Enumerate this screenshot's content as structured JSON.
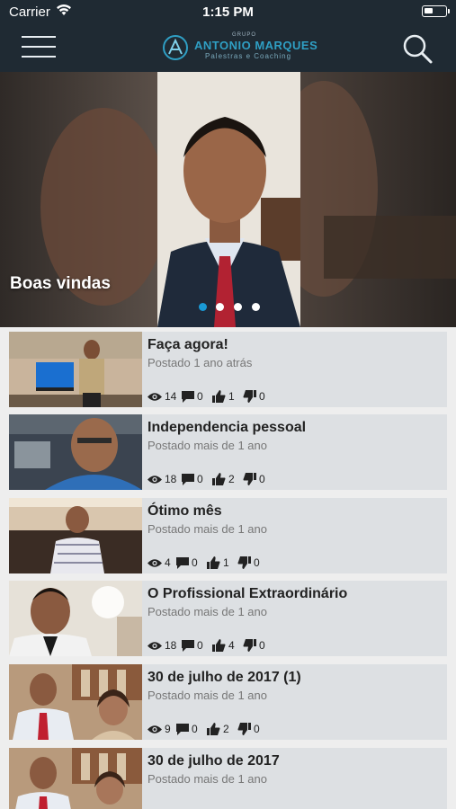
{
  "status_bar": {
    "carrier": "Carrier",
    "time": "1:15 PM"
  },
  "header": {
    "logo_group": "GRUPO",
    "logo_name": "ANTONIO MARQUES",
    "logo_tagline": "Palestras e Coaching"
  },
  "hero": {
    "title": "Boas vindas",
    "slide_count": 4,
    "active_slide": 0,
    "accent": "#1a9ad6"
  },
  "videos": [
    {
      "title": "Faça agora!",
      "posted": "Postado 1 ano atrás",
      "views": "14",
      "comments": "0",
      "likes": "1",
      "dislikes": "0"
    },
    {
      "title": "Independencia pessoal",
      "posted": "Postado mais de 1 ano",
      "views": "18",
      "comments": "0",
      "likes": "2",
      "dislikes": "0"
    },
    {
      "title": "Ótimo mês",
      "posted": "Postado mais de 1 ano",
      "views": "4",
      "comments": "0",
      "likes": "1",
      "dislikes": "0"
    },
    {
      "title": "O Profissional Extraordinário",
      "posted": "Postado mais de 1 ano",
      "views": "18",
      "comments": "0",
      "likes": "4",
      "dislikes": "0"
    },
    {
      "title": "30 de julho de 2017 (1)",
      "posted": "Postado mais de 1 ano",
      "views": "9",
      "comments": "0",
      "likes": "2",
      "dislikes": "0"
    },
    {
      "title": "30 de julho de 2017",
      "posted": "Postado mais de 1 ano",
      "views": "",
      "comments": "",
      "likes": "",
      "dislikes": ""
    }
  ],
  "colors": {
    "header_bg": "#1f2a33",
    "card_bg": "#dde0e3",
    "list_bg": "#eeeeee"
  },
  "icons": [
    "menu-icon",
    "search-icon",
    "eye-icon",
    "comment-icon",
    "thumbs-up-icon",
    "thumbs-down-icon"
  ]
}
